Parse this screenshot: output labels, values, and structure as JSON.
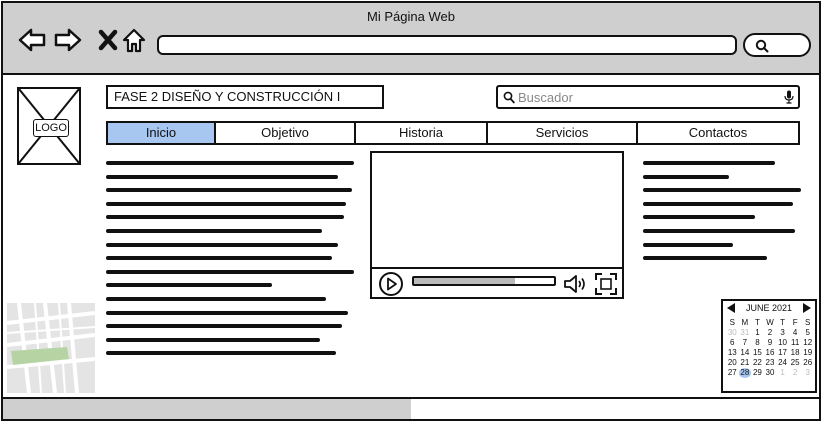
{
  "window": {
    "title": "Mi Página Web"
  },
  "browser": {
    "back_icon": "arrow-left-icon",
    "forward_icon": "arrow-right-icon",
    "stop_icon": "close-icon",
    "home_icon": "home-icon",
    "address": ""
  },
  "site": {
    "logo_label": "LOGO",
    "title": "FASE 2 DISEÑO Y CONSTRUCCIÓN I",
    "search_placeholder": "Buscador",
    "tabs": [
      {
        "label": "Inicio",
        "active": true
      },
      {
        "label": "Objetivo",
        "active": false
      },
      {
        "label": "Historia",
        "active": false
      },
      {
        "label": "Servicios",
        "active": false
      },
      {
        "label": "Contactos",
        "active": false
      }
    ]
  },
  "video": {
    "progress": 0.72
  },
  "calendar": {
    "month_label": "JUNE 2021",
    "weekdays": [
      "S",
      "M",
      "T",
      "W",
      "T",
      "F",
      "S"
    ],
    "days": [
      [
        "30",
        "31",
        "1",
        "2",
        "3",
        "4",
        "5"
      ],
      [
        "6",
        "7",
        "8",
        "9",
        "10",
        "11",
        "12"
      ],
      [
        "13",
        "14",
        "15",
        "16",
        "17",
        "18",
        "19"
      ],
      [
        "20",
        "21",
        "22",
        "23",
        "24",
        "25",
        "26"
      ],
      [
        "27",
        "28",
        "29",
        "30",
        "1",
        "2",
        "3"
      ]
    ],
    "selected": "28"
  },
  "page_progress": 0.5,
  "colors": {
    "active_tab": "#a7c6f0",
    "chrome": "#cfcfcf"
  }
}
